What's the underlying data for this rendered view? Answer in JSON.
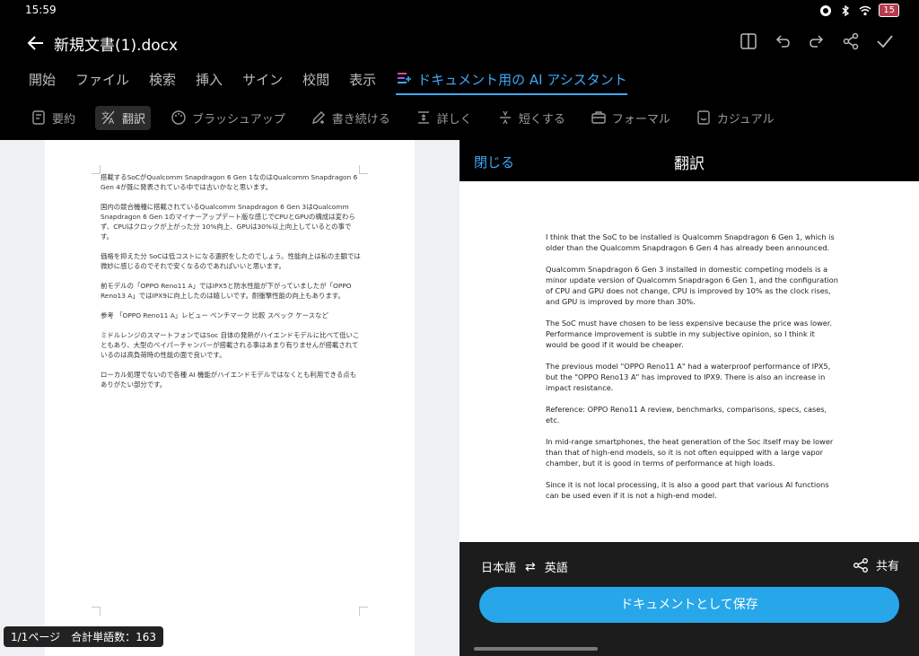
{
  "status": {
    "time": "15:59",
    "battery": "15"
  },
  "titlebar": {
    "title": "新規文書(1).docx"
  },
  "menu_tabs": [
    "開始",
    "ファイル",
    "検索",
    "挿入",
    "サイン",
    "校閲",
    "表示"
  ],
  "ai_tab": {
    "label": "ドキュメント用の AI アシスタント"
  },
  "tools": [
    {
      "label": "要約",
      "icon": "summary-icon"
    },
    {
      "label": "翻訳",
      "icon": "translate-icon"
    },
    {
      "label": "ブラッシュアップ",
      "icon": "palette-icon"
    },
    {
      "label": "書き続ける",
      "icon": "pen-icon"
    },
    {
      "label": "詳しく",
      "icon": "expand-icon"
    },
    {
      "label": "短くする",
      "icon": "shorten-icon"
    },
    {
      "label": "フォーマル",
      "icon": "briefcase-icon"
    },
    {
      "label": "カジュアル",
      "icon": "casual-icon"
    }
  ],
  "document": {
    "paragraphs": [
      "搭載するSoCがQualcomm Snapdragon 6 Gen 1なのはQualcomm Snapdragon 6 Gen 4が既に発表されている中では古いかなと思います。",
      "国内の競合機種に搭載されているQualcomm Snapdragon 6 Gen 3はQualcomm Snapdragon 6 Gen 1のマイナーアップデート版な感じでCPUとGPUの構成は変わらず、CPUはクロックが上がった分 10%向上、GPUは30%以上向上しているとの事です。",
      "価格を抑えた分 SoCは低コストになる選択をしたのでしょう。性能向上は私の主観では微妙に感じるのでそれで安くなるのであればいいと思います。",
      "前モデルの「OPPO Reno11 A」ではIPX5と防水性能が下がっていましたが「OPPO Reno13 A」ではIPX9に向上したのは嬉しいです。耐衝撃性能の向上もあります。",
      "参考 「OPPO Reno11 A」レビュー ベンチマーク 比較 スペック ケースなど",
      "ミドルレンジのスマートフォンではSoc 自体の発熱がハイエンドモデルに比べて低いこともあり、大型のベイパーチャンバーが搭載される事はあまり有りませんが搭載されているのは高負荷時の性能の面で良いです。",
      "ローカル処理でないので各種 AI 機能がハイエンドモデルではなくとも利用できる点もありがたい部分です。"
    ]
  },
  "page_info": "1/1ページ　合計単語数：163",
  "panel": {
    "close": "閉じる",
    "title": "翻訳",
    "paragraphs": [
      "I think that the SoC to be installed is Qualcomm Snapdragon 6 Gen 1, which is older than the Qualcomm Snapdragon 6 Gen 4 has already been announced.",
      "Qualcomm Snapdragon 6 Gen 3 installed in domestic competing models is a minor update version of Qualcomm Snapdragon 6 Gen 1, and the configuration of CPU and GPU does not change, CPU is improved by 10% as the clock rises, and GPU is improved by more than 30%.",
      "The SoC must have chosen to be less expensive because the price was lower. Performance improvement is subtle in my subjective opinion, so I think it would be good if it would be cheaper.",
      "The previous model \"OPPO Reno11 A\" had a waterproof performance of IPX5, but the \"OPPO Reno13 A\" has improved to IPX9. There is also an increase in impact resistance.",
      "Reference: OPPO Reno11 A review, benchmarks, comparisons, specs, cases, etc.",
      "In mid-range smartphones, the heat generation of the Soc itself may be lower than that of high-end models, so it is not often equipped with a large vapor chamber, but it is good in terms of performance at high loads.",
      "Since it is not local processing, it is also a good part that various AI functions can be used even if it is not a high-end model."
    ],
    "source_lang": "日本語",
    "swap": "⇄",
    "target_lang": "英語",
    "share": "共有",
    "save": "ドキュメントとして保存"
  },
  "colors": {
    "accent": "#3fa9f5",
    "button": "#27a7ea"
  }
}
